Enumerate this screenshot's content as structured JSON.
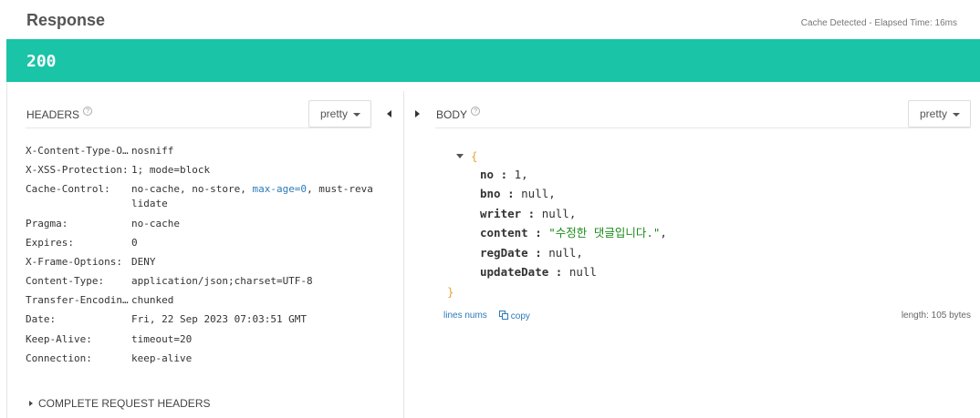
{
  "response": {
    "title": "Response",
    "cache_text": "Cache Detected - Elapsed Time: 16ms",
    "status_code": "200",
    "status_color": "#19c4a7"
  },
  "headers_panel": {
    "title": "HEADERS",
    "help_icon": "help-circle-icon",
    "format_label": "pretty",
    "rows": [
      {
        "name": "X-Content-Type-O…",
        "value": "nosniff"
      },
      {
        "name": "X-XSS-Protection:",
        "value": "1; mode=block"
      },
      {
        "name": "Cache-Control:",
        "value_pre": "no-cache, no-store, ",
        "value_kw": "max-age=0",
        "value_post": ", must-revalidate"
      },
      {
        "name": "Pragma:",
        "value": "no-cache"
      },
      {
        "name": "Expires:",
        "value": "0"
      },
      {
        "name": "X-Frame-Options:",
        "value": "DENY"
      },
      {
        "name": "Content-Type:",
        "value": "application/json;charset=UTF-8"
      },
      {
        "name": "Transfer-Encodin…",
        "value": "chunked"
      },
      {
        "name": "Date:",
        "value": "Fri, 22 Sep 2023 07:03:51 GMT"
      },
      {
        "name": "Keep-Alive:",
        "value": "timeout=20"
      },
      {
        "name": "Connection:",
        "value": "keep-alive"
      }
    ],
    "complete_label": "COMPLETE REQUEST HEADERS"
  },
  "body_panel": {
    "title": "BODY",
    "help_icon": "help-circle-icon",
    "format_label": "pretty",
    "json": {
      "open_brace": "{",
      "close_brace": "}",
      "fields": [
        {
          "key": "no",
          "value": "1,",
          "kind": "num"
        },
        {
          "key": "bno",
          "value": "null,",
          "kind": "null"
        },
        {
          "key": "writer",
          "value": "null,",
          "kind": "null"
        },
        {
          "key": "content",
          "value": "\"수정한 댓글입니다.\"",
          "suffix": ",",
          "kind": "str"
        },
        {
          "key": "regDate",
          "value": "null,",
          "kind": "null"
        },
        {
          "key": "updateDate",
          "value": "null",
          "kind": "null"
        }
      ]
    },
    "lines_nums_label": "lines nums",
    "copy_label": "copy",
    "copy_icon": "copy-icon",
    "length_text": "length: 105 bytes"
  }
}
